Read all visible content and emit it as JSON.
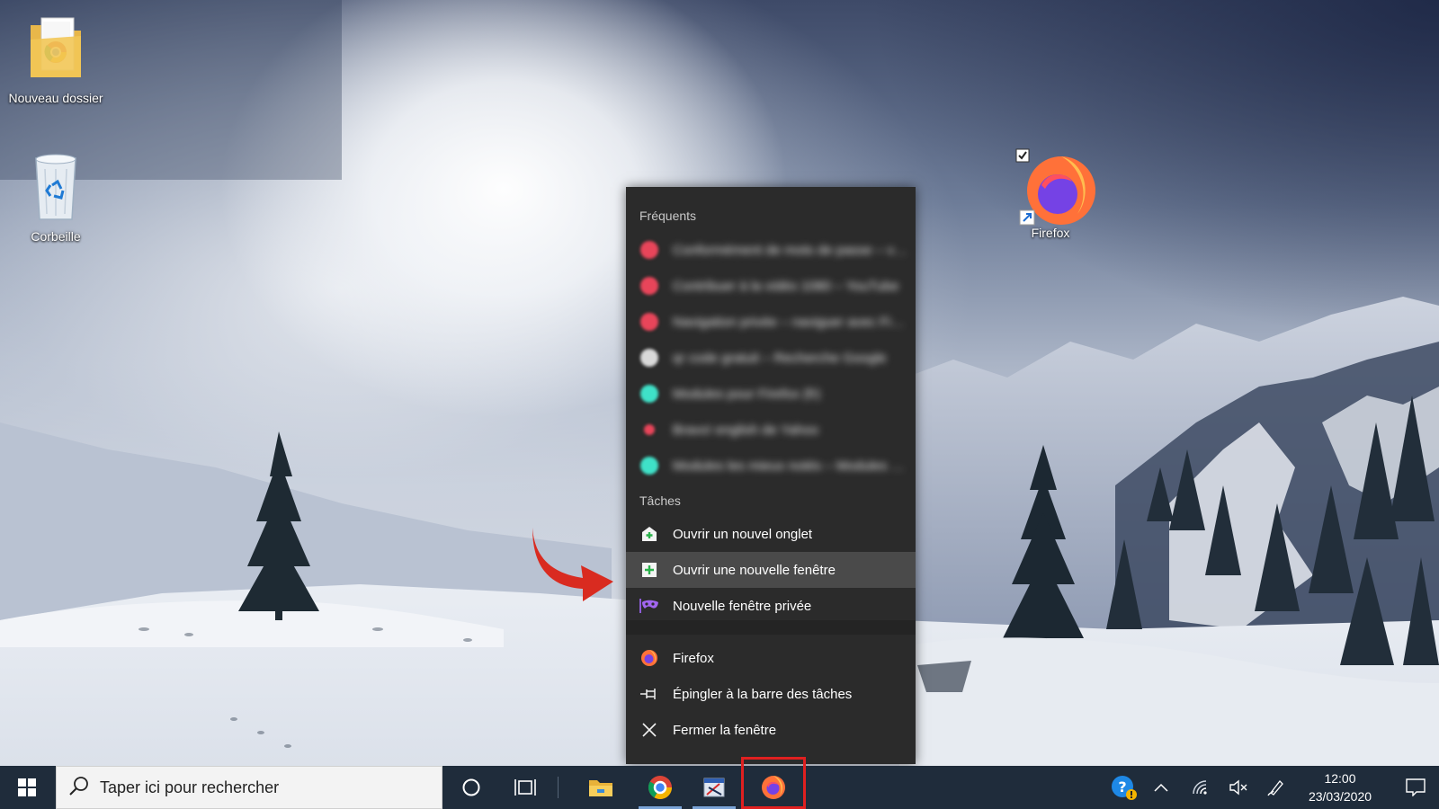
{
  "desktop": {
    "icons": [
      {
        "label": "Nouveau dossier"
      },
      {
        "label": "Corbeille"
      },
      {
        "label": "Firefox"
      }
    ]
  },
  "jumplist": {
    "frequent_title": "Fréquents",
    "frequent_items": [
      {
        "label": "Conformément de mots de passe – victor…",
        "icon_color": "#e8455a"
      },
      {
        "label": "Contribuer à la vidéo 1080 – YouTube",
        "icon_color": "#e8455a"
      },
      {
        "label": "Navigation privée – naviguer avec Fire…",
        "icon_color": "#e8455a"
      },
      {
        "label": "qr code gratuit – Recherche Google",
        "icon_color": "#d9d9d9"
      },
      {
        "label": "Modules pour Firefox (fr)",
        "icon_color": "#3fe1c8"
      },
      {
        "label": "Bravo! english de Yahoo",
        "icon_color": "#e8455a"
      },
      {
        "label": "Modules les mieux notés – Modules p…",
        "icon_color": "#3fe1c8"
      }
    ],
    "tasks_title": "Tâches",
    "tasks": [
      {
        "label": "Ouvrir un nouvel onglet"
      },
      {
        "label": "Ouvrir une nouvelle fenêtre"
      },
      {
        "label": "Nouvelle fenêtre privée"
      }
    ],
    "app_items": [
      {
        "label": "Firefox"
      },
      {
        "label": "Épingler à la barre des tâches"
      },
      {
        "label": "Fermer la fenêtre"
      }
    ]
  },
  "taskbar": {
    "search_placeholder": "Taper ici pour rechercher",
    "clock_time": "12:00",
    "clock_date": "23/03/2020"
  },
  "colors": {
    "taskbar": "#1f2c3b",
    "jumplist_bg": "#2b2b2b",
    "highlight_red": "#e02020",
    "arrow_red": "#d92b20"
  }
}
